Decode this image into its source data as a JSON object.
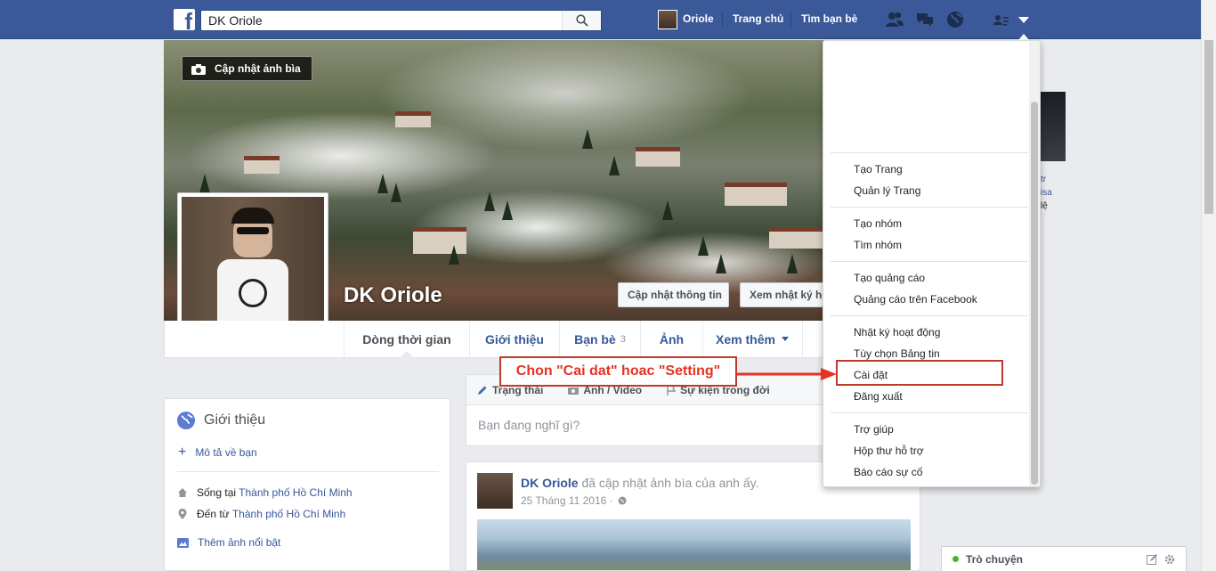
{
  "topbar": {
    "search_value": "DK Oriole",
    "profile_name": "Oriole",
    "home_label": "Trang chủ",
    "find_friends_label": "Tìm bạn bè",
    "brand_color": "#3b5998"
  },
  "cover": {
    "update_cover_label": "Cập nhật ảnh bìa",
    "profile_name": "DK Oriole",
    "update_info_label": "Cập nhật thông tin",
    "view_activity_label": "Xem nhật ký hoạt động"
  },
  "nav": {
    "tabs": [
      {
        "label": "Dòng thời gian"
      },
      {
        "label": "Giới thiệu"
      },
      {
        "label": "Bạn bè",
        "count": "3"
      },
      {
        "label": "Ảnh"
      },
      {
        "label": "Xem thêm"
      }
    ]
  },
  "intro": {
    "title": "Giới thiệu",
    "describe_link": "Mô tả về bạn",
    "lives_prefix": "Sống tại",
    "lives_city": "Thành phố Hồ Chí Minh",
    "from_prefix": "Đến từ",
    "from_city": "Thành phố Hồ Chí Minh",
    "featured_link": "Thêm ảnh nổi bật"
  },
  "composer": {
    "tab_status": "Trạng thái",
    "tab_photo": "Ảnh / Video",
    "tab_life_event": "Sự kiện trong đời",
    "placeholder": "Bạn đang nghĩ gì?"
  },
  "post": {
    "author": "DK Oriole",
    "action": "đã cập nhật ảnh bìa của anh ấy.",
    "time": "25 Tháng 11 2016 ·"
  },
  "right": {
    "text1": "tr",
    "text2": "isa",
    "text3": "lệ"
  },
  "chat": {
    "label": "Trò chuyện"
  },
  "dropdown": {
    "groups": [
      [
        "Tạo Trang",
        "Quản lý Trang"
      ],
      [
        "Tạo nhóm",
        "Tìm nhóm"
      ],
      [
        "Tạo quảng cáo",
        "Quảng cáo trên Facebook"
      ],
      [
        "Nhật ký hoạt động",
        "Tùy chọn Bảng tin",
        "Cài đặt",
        "Đăng xuất"
      ],
      [
        "Trợ giúp",
        "Hộp thư hỗ trợ",
        "Báo cáo sự cố"
      ]
    ]
  },
  "annotation": {
    "text": "Chon \"Cai dat\" hoac \"Setting\"",
    "color": "#e53222"
  }
}
